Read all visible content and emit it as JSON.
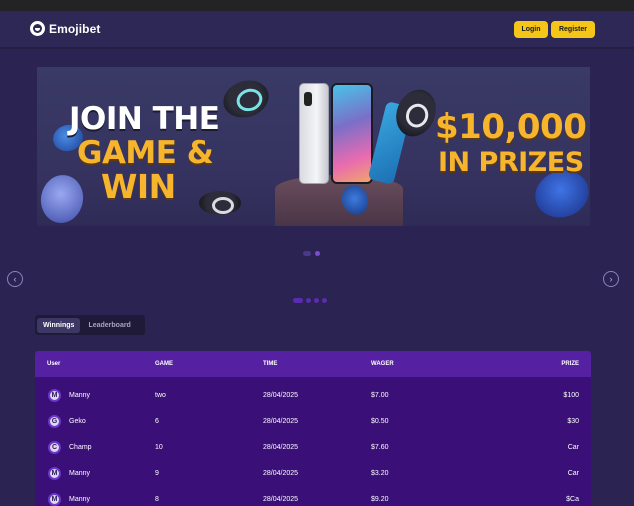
{
  "header": {
    "logo_text": "Emojibet",
    "login_label": "Login",
    "register_label": "Register"
  },
  "banner": {
    "line1": "JOIN THE",
    "line2": "GAME &",
    "line3": "WIN",
    "amount": "$10,000",
    "prizes": "IN PRIZES"
  },
  "carousel": {
    "prev_icon": "chevron-left-icon",
    "next_icon": "chevron-right-icon",
    "prev_glyph": "‹",
    "next_glyph": "›"
  },
  "tabs": [
    {
      "label": "Winnings",
      "active": true
    },
    {
      "label": "Leaderboard",
      "active": false
    }
  ],
  "table": {
    "headers": {
      "user": "User",
      "game": "GAME",
      "time": "TIME",
      "wager": "WAGER",
      "prize": "PRIZE"
    },
    "rows": [
      {
        "initial": "M",
        "user": "Manny",
        "game": "two",
        "time": "28/04/2025",
        "wager": "$7.00",
        "prize": "$100"
      },
      {
        "initial": "G",
        "user": "Geko",
        "game": "6",
        "time": "28/04/2025",
        "wager": "$0.50",
        "prize": "$30"
      },
      {
        "initial": "C",
        "user": "Champ",
        "game": "10",
        "time": "28/04/2025",
        "wager": "$7.60",
        "prize": "Car"
      },
      {
        "initial": "M",
        "user": "Manny",
        "game": "9",
        "time": "28/04/2025",
        "wager": "$3.20",
        "prize": "Car"
      },
      {
        "initial": "M",
        "user": "Manny",
        "game": "8",
        "time": "28/04/2025",
        "wager": "$9.20",
        "prize": "$Ca"
      }
    ]
  },
  "colors": {
    "page_bg": "#2b2452",
    "accent_yellow": "#f5c518",
    "table_header": "#5520a2",
    "table_body": "#3a1078"
  }
}
